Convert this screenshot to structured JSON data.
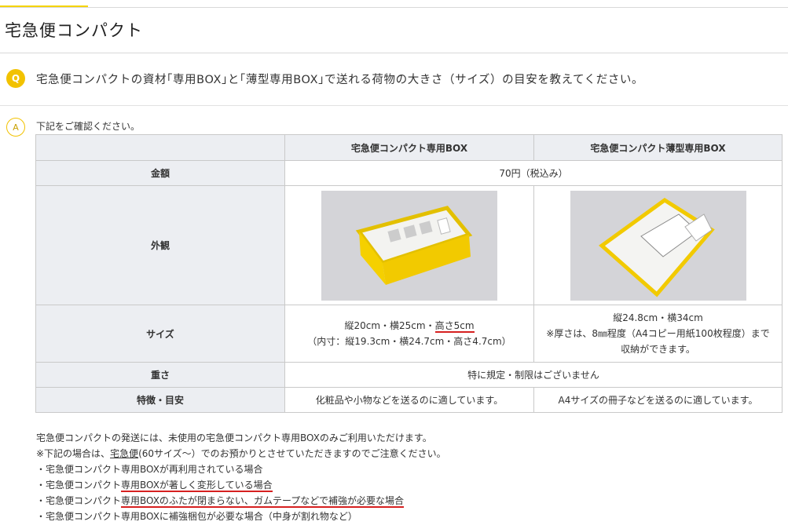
{
  "page": {
    "title": "宅急便コンパクト"
  },
  "qa": {
    "q_mark": "Q",
    "question": "宅急便コンパクトの資材｢専用BOX｣と｢薄型専用BOX｣で送れる荷物の大きさ（サイズ）の目安を教えてください。",
    "a_mark": "A",
    "intro": "下記をご確認ください。"
  },
  "table": {
    "headers": [
      "",
      "宅急便コンパクト専用BOX",
      "宅急便コンパクト薄型専用BOX"
    ],
    "price_label": "金額",
    "price_value": "70円（税込み）",
    "appearance_label": "外観",
    "size_label": "サイズ",
    "size_box_line1_part1": "縦20cm・横25cm・",
    "size_box_line1_part2": "高さ5cm",
    "size_box_line2": "（内寸：縦19.3cm・横24.7cm・高さ4.7cm）",
    "size_thin_line1": "縦24.8cm・横34cm",
    "size_thin_line2": "※厚さは、8㎜程度（A4コピー用紙100枚程度）まで",
    "size_thin_line3": "収納ができます。",
    "weight_label": "重さ",
    "weight_value": "特に規定・制限はございません",
    "feature_label": "特徴・目安",
    "feature_box": "化粧品や小物などを送るのに適しています。",
    "feature_thin": "A4サイズの冊子などを送るのに適しています。"
  },
  "notes": {
    "line1": "宅急便コンパクトの発送には、未使用の宅急便コンパクト専用BOXのみご利用いただけます。",
    "line2_pre": "※下記の場合は、",
    "line2_link": "宅急便",
    "line2_post": "(60サイズ～）でのお預かりとさせていただきますのでご注意ください。",
    "bullet1": "・宅急便コンパクト専用BOXが再利用されている場合",
    "bullet2_pre": "・宅急便コンパクト",
    "bullet2_mark": "専用BOXが著しく変形している場合",
    "bullet3_pre": "・宅急便コンパクト",
    "bullet3_mark1": "専用BOXのふたが閉まらない、",
    "bullet3_mark2": "ガムテープなどで補強が必要な場合",
    "bullet4": "・宅急便コンパクト専用BOXに補強梱包が必要な場合（中身が割れ物など）"
  },
  "colors": {
    "accent": "#f2c200",
    "annotation_red": "#d62020",
    "table_header_bg": "#eceef2"
  }
}
